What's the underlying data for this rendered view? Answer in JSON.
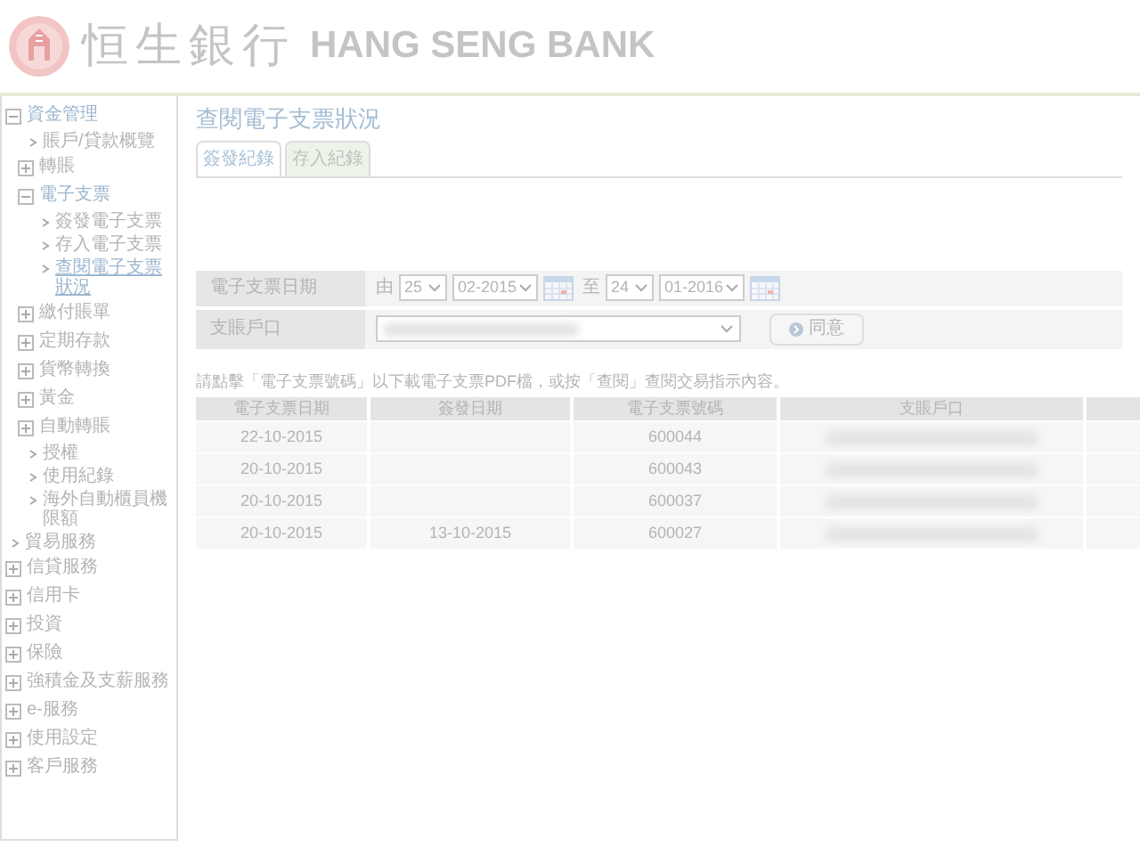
{
  "header": {
    "bank_name_chinese": "恒生銀行",
    "bank_name_english": "HANG SENG BANK"
  },
  "sidebar": {
    "items": [
      {
        "kind": "group",
        "label": "資金管理",
        "expanded": true,
        "children": [
          {
            "kind": "link",
            "label": "賬戶/貸款概覽",
            "selected": false
          },
          {
            "kind": "group",
            "label": "轉賬",
            "expanded": false
          },
          {
            "kind": "group",
            "label": "電子支票",
            "expanded": true,
            "children": [
              {
                "kind": "link",
                "label": "簽發電子支票",
                "selected": false
              },
              {
                "kind": "link",
                "label": "存入電子支票",
                "selected": false
              },
              {
                "kind": "link",
                "label": "查閱電子支票狀況",
                "selected": true
              }
            ]
          },
          {
            "kind": "group",
            "label": "繳付賬單",
            "expanded": false
          },
          {
            "kind": "group",
            "label": "定期存款",
            "expanded": false
          },
          {
            "kind": "group",
            "label": "貨幣轉換",
            "expanded": false
          },
          {
            "kind": "group",
            "label": "黃金",
            "expanded": false
          },
          {
            "kind": "group",
            "label": "自動轉賬",
            "expanded": false
          },
          {
            "kind": "link",
            "label": "授權",
            "selected": false
          },
          {
            "kind": "link",
            "label": "使用紀錄",
            "selected": false
          },
          {
            "kind": "link",
            "label": "海外自動櫃員機限額",
            "selected": false
          }
        ]
      },
      {
        "kind": "link",
        "label": "貿易服務",
        "selected": false
      },
      {
        "kind": "group",
        "label": "信貸服務",
        "expanded": false
      },
      {
        "kind": "group",
        "label": "信用卡",
        "expanded": false
      },
      {
        "kind": "group",
        "label": "投資",
        "expanded": false
      },
      {
        "kind": "group",
        "label": "保險",
        "expanded": false
      },
      {
        "kind": "group",
        "label": "強積金及支薪服務",
        "expanded": false
      },
      {
        "kind": "group",
        "label": "e-服務",
        "expanded": false
      },
      {
        "kind": "group",
        "label": "使用設定",
        "expanded": false
      },
      {
        "kind": "group",
        "label": "客戶服務",
        "expanded": false
      }
    ]
  },
  "page_title": "查閱電子支票狀況",
  "tabs": [
    {
      "label": "簽發紀錄",
      "selected": true
    },
    {
      "label": "存入紀錄",
      "selected": false
    }
  ],
  "form": {
    "date_label": "電子支票日期",
    "from_label": "由",
    "from_day": "25",
    "from_month": "02-2015",
    "to_label": "至",
    "to_day": "24",
    "to_month": "01-2016",
    "account_label": "支賬戶口",
    "submit": "同意"
  },
  "instruction": "請點擊「電子支票號碼」以下載電子支票PDF檔，或按「查閱」查閱交易指示內容。",
  "table": {
    "columns": [
      "電子支票日期",
      "簽發日期",
      "電子支票號碼",
      "支賬戶口"
    ],
    "rows": [
      [
        "22-10-2015",
        "",
        "600044"
      ],
      [
        "20-10-2015",
        "",
        "600043"
      ],
      [
        "20-10-2015",
        "",
        "600037"
      ],
      [
        "20-10-2015",
        "13-10-2015",
        "600027"
      ]
    ]
  }
}
